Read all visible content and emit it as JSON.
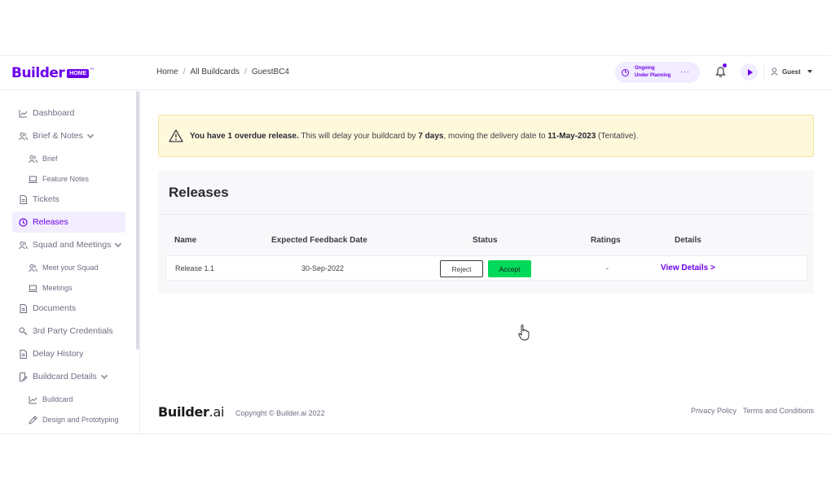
{
  "header": {
    "logo_text": "Builder",
    "logo_badge": "HOME",
    "logo_tm": "™",
    "breadcrumb": [
      "Home",
      "All Buildcards",
      "GuestBC4"
    ],
    "breadcrumb_sep": "/",
    "status_line1": "Ongoing",
    "status_line2": "Under Planning",
    "status_more": "···",
    "user_name": "Guest"
  },
  "sidebar": {
    "items": [
      {
        "label": "Dashboard",
        "icon": "chart-icon"
      },
      {
        "label": "Brief & Notes",
        "icon": "users-icon",
        "expandable": true
      },
      {
        "label": "Brief",
        "icon": "users-icon",
        "sub": true
      },
      {
        "label": "Feature Notes",
        "icon": "laptop-icon",
        "sub": true
      },
      {
        "label": "Tickets",
        "icon": "document-icon"
      },
      {
        "label": "Releases",
        "icon": "clock-icon",
        "active": true
      },
      {
        "label": "Squad and Meetings",
        "icon": "users-icon",
        "expandable": true
      },
      {
        "label": "Meet your Squad",
        "icon": "users-icon",
        "sub": true
      },
      {
        "label": "Meetings",
        "icon": "laptop-icon",
        "sub": true
      },
      {
        "label": "Documents",
        "icon": "document-icon"
      },
      {
        "label": "3rd Party Credentials",
        "icon": "credentials-icon"
      },
      {
        "label": "Delay History",
        "icon": "document-icon"
      },
      {
        "label": "Buildcard Details",
        "icon": "document-edit-icon",
        "expandable": true
      },
      {
        "label": "Buildcard",
        "icon": "chart-icon",
        "sub": true
      },
      {
        "label": "Design and Prototyping",
        "icon": "pen-icon",
        "sub": true
      }
    ]
  },
  "alert": {
    "part1": "You have 1 overdue release.",
    "part2": " This will delay your buildcard by ",
    "part3": "7 days",
    "part4": ", moving the delivery date to ",
    "part5": "11-May-2023",
    "part6": " (Tentative)."
  },
  "releases": {
    "title": "Releases",
    "columns": [
      "Name",
      "Expected Feedback Date",
      "Status",
      "Ratings",
      "Details"
    ],
    "rows": [
      {
        "name": "Release 1.1",
        "date": "30-Sep-2022",
        "reject_label": "Reject",
        "accept_label": "Accept",
        "rating": "-",
        "details_label": "View Details >"
      }
    ]
  },
  "footer": {
    "logo_bold": "Builder",
    "logo_rest": ".ai",
    "copyright": "Copyright © Builder.ai 2022",
    "links": [
      "Privacy Policy",
      "Terms and Conditions"
    ]
  },
  "colors": {
    "brand": "#6c00ea",
    "accept": "#00d95a",
    "alert_bg": "#fff9dc"
  }
}
